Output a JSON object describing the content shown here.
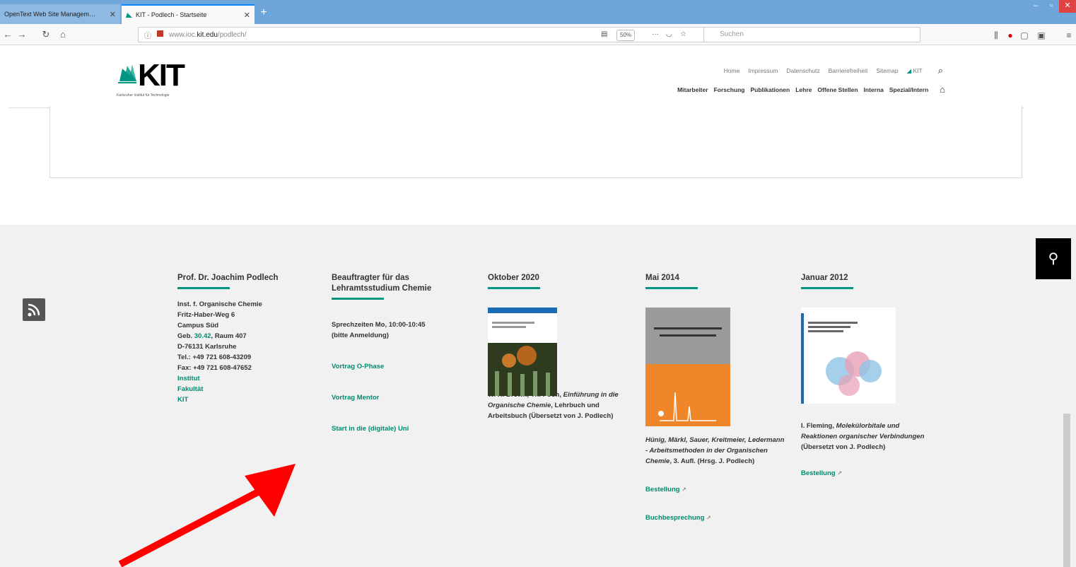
{
  "browser": {
    "tabs": [
      {
        "label": "OpenText Web Site Managem…"
      },
      {
        "label": "KIT - Podlech - Startseite"
      }
    ],
    "url_prefix": "www.ioc.",
    "url_domain": "kit.edu",
    "url_suffix": "/podlech/",
    "zoom": "50%",
    "search_placeholder": "Suchen"
  },
  "header": {
    "logo_text": "KIT",
    "logo_subtitle": "Karlsruher Institut für Technologie",
    "meta_nav": [
      "Home",
      "Impressum",
      "Datenschutz",
      "Barrierefreiheit",
      "Sitemap",
      "KIT"
    ],
    "main_nav": [
      "Mitarbeiter",
      "Forschung",
      "Publikationen",
      "Lehre",
      "Offene Stellen",
      "Interna",
      "Spezial/Intern"
    ]
  },
  "footer": {
    "col1": {
      "title": "Prof. Dr. Joachim Podlech",
      "lines": [
        "Inst. f. Organische Chemie",
        "Fritz-Haber-Weg 6",
        "Campus Süd"
      ],
      "geb_prefix": "Geb. ",
      "geb_link": "30.42",
      "geb_suffix": ", Raum 407",
      "city": "D-76131 Karlsruhe",
      "tel": "Tel.: +49 721 608-43209",
      "fax": "Fax: +49 721 608-47652",
      "links": [
        "Institut",
        "Fakultät",
        "KIT"
      ]
    },
    "col2": {
      "title": "Beauftragter für das Lehramtsstudium Chemie",
      "hours": "Sprechzeiten Mo, 10:00-10:45",
      "hours_note": "(bitte Anmeldung)",
      "links": [
        "Vortrag O-Phase",
        "Vortrag Mentor",
        "Start in die (digitale) Uni"
      ]
    },
    "col3": {
      "title": "Oktober 2020",
      "authors": "W. H. Brown, Th. Poon, ",
      "book_title": "Einführung in die Organische Chemie",
      "desc": ", Lehrbuch und Arbeitsbuch (Übersetzt von J. Podlech)"
    },
    "col4": {
      "title": "Mai 2014",
      "book_title": "Hünig, Märkl, Sauer, Kreitmeier, Ledermann - Arbeitsmethoden in der Organischen Chemie",
      "desc": ", 3. Aufl. (Hrsg. J. Podlech)",
      "link1": "Bestellung",
      "link2": "Buchbesprechung"
    },
    "col5": {
      "title": "Januar 2012",
      "authors": "I. Fleming, ",
      "book_title": "Molekülorbitale und Reaktionen organischer Verbindungen",
      "desc": " (Übersetzt von J. Podlech)",
      "link1": "Bestellung"
    }
  },
  "colors": {
    "kit_green": "#009682",
    "link_green": "#008a6e",
    "arrow_red": "#ff0000"
  }
}
